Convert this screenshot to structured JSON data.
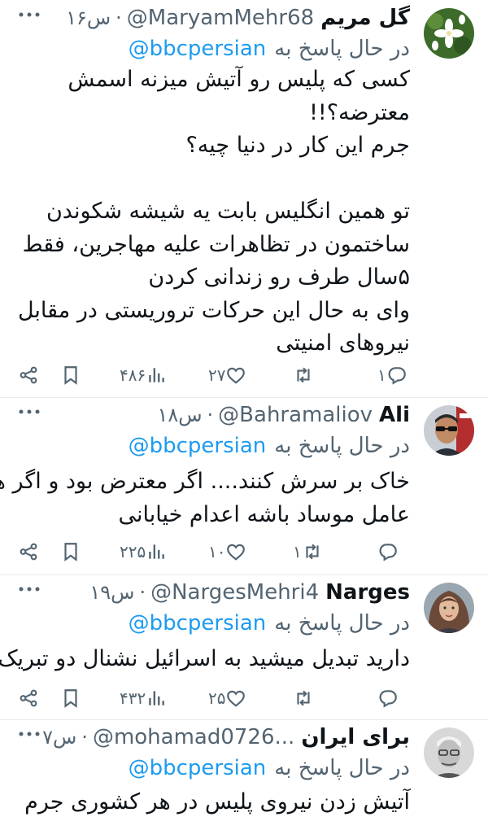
{
  "reply_prefix": "در حال پاسخ به",
  "tweets": [
    {
      "name": "گل مریم",
      "handle": "@MaryamMehr68",
      "time": "۱۶س",
      "reply_to": "@bbcpersian",
      "lines": [
        "کسی که پلیس رو آتیش میزنه اسمش",
        "معترضه؟!!",
        "جرم این کار در دنیا چیه؟",
        "",
        "تو همین انگلیس بابت یه شیشه شکوندن",
        "ساختمون در تظاهرات علیه مهاجرین، فقط",
        "۵سال طرف رو زندانی کردن",
        "وای به حال این حرکات تروریستی در مقابل",
        "نیروهای امنیتی"
      ],
      "replies": "۱",
      "retweets": "",
      "likes": "۲۷",
      "views": "۴۸۶",
      "avatar": "flower-avatar"
    },
    {
      "name": "Ali",
      "handle": "@Bahramaliov",
      "time": "۱۸س",
      "reply_to": "@bbcpersian",
      "lines": [
        "خاک بر سرش کنند.... اگر معترض بود و اگر هم",
        "عامل موساد باشه اعدام خیابانی"
      ],
      "replies": "",
      "retweets": "۱",
      "likes": "۱۰",
      "views": "۲۲۵",
      "avatar": "man-sunglasses-avatar"
    },
    {
      "name": "Narges",
      "handle": "@NargesMehri4",
      "time": "۱۹س",
      "reply_to": "@bbcpersian",
      "lines": [
        "دارید تبدیل میشید به اسرائیل نشنال دو تبریک"
      ],
      "replies": "",
      "retweets": "",
      "likes": "۲۵",
      "views": "۴۳۲",
      "avatar": "woman-avatar"
    },
    {
      "name": "برای ایران",
      "handle": "@mohamad0726...",
      "time": "۷س",
      "reply_to": "@bbcpersian",
      "lines": [
        "آتیش زدن نیروی پلیس در هر کشوری جرم"
      ],
      "replies": "",
      "retweets": "",
      "likes": "",
      "views": "",
      "avatar": "older-man-avatar"
    }
  ]
}
